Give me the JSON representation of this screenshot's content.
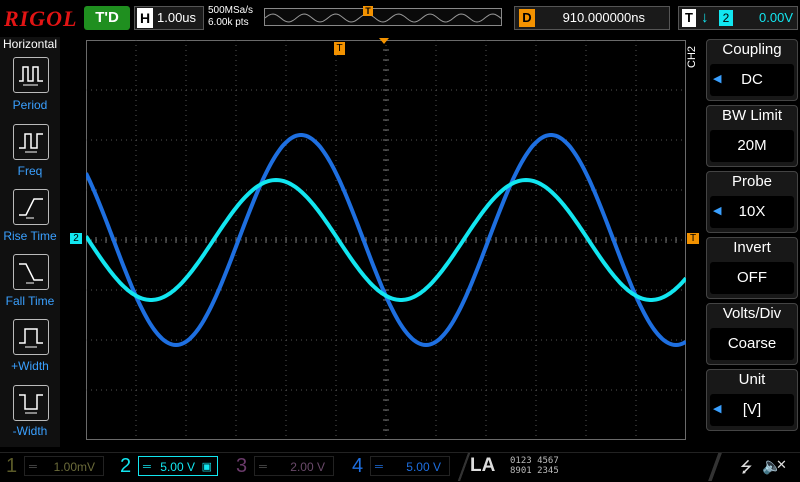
{
  "brand": "RIGOL",
  "status": "T'D",
  "timebase": {
    "label": "H",
    "value": "1.00us"
  },
  "sampling": {
    "rate": "500MSa/s",
    "points": "6.00k pts"
  },
  "trigger_position_marker": "T",
  "delay": {
    "label": "D",
    "value": "910.000000ns"
  },
  "trigger": {
    "label": "T",
    "edge": "↓",
    "source": "2",
    "level": "0.00V"
  },
  "left_panel": {
    "title": "Horizontal",
    "items": [
      {
        "label": "Period",
        "icon": "period-icon"
      },
      {
        "label": "Freq",
        "icon": "freq-icon"
      },
      {
        "label": "Rise Time",
        "icon": "rise-time-icon"
      },
      {
        "label": "Fall Time",
        "icon": "fall-time-icon"
      },
      {
        "label": "+Width",
        "icon": "positive-width-icon"
      },
      {
        "label": "-Width",
        "icon": "negative-width-icon"
      }
    ]
  },
  "screen": {
    "ch2_marker": "2",
    "trigger_level_marker": "T",
    "trigger_time_marker": "T"
  },
  "channel_menu": {
    "channel": "CH2",
    "items": [
      {
        "title": "Coupling",
        "value": "DC",
        "has_arrow": true
      },
      {
        "title": "BW Limit",
        "value": "20M",
        "has_arrow": false
      },
      {
        "title": "Probe",
        "value": "10X",
        "has_arrow": true
      },
      {
        "title": "Invert",
        "value": "OFF",
        "has_arrow": false
      },
      {
        "title": "Volts/Div",
        "value": "Coarse",
        "has_arrow": false
      },
      {
        "title": "Unit",
        "value": "[V]",
        "has_arrow": true
      }
    ]
  },
  "channels": [
    {
      "num": "1",
      "scale": "1.00mV",
      "color": "#6a6a2a",
      "active": false
    },
    {
      "num": "2",
      "scale": "5.00 V",
      "color": "#12e6f0",
      "active": true
    },
    {
      "num": "3",
      "scale": "2.00 V",
      "color": "#7a3a7a",
      "active": false
    },
    {
      "num": "4",
      "scale": "5.00 V",
      "color": "#1e6fe0",
      "active": false
    }
  ],
  "la": {
    "label": "LA",
    "row1": "0123 4567",
    "row2": "8901 2345"
  },
  "colors": {
    "ch1_yellow": "#e6e600",
    "ch2_cyan": "#12e6f0",
    "ch4_blue": "#1e6fe0",
    "trigger_orange": "#f39200",
    "brand_red": "#e21414"
  },
  "waveforms": [
    {
      "channel": "4",
      "color": "#1e6fe0",
      "shape": "sine",
      "amplitude_div": 2.1,
      "period_div": 5.0,
      "phase_note": "peak near 4.3 div"
    },
    {
      "channel": "2",
      "color": "#12e6f0",
      "shape": "sine",
      "amplitude_div": 1.2,
      "period_div": 5.0
    }
  ]
}
